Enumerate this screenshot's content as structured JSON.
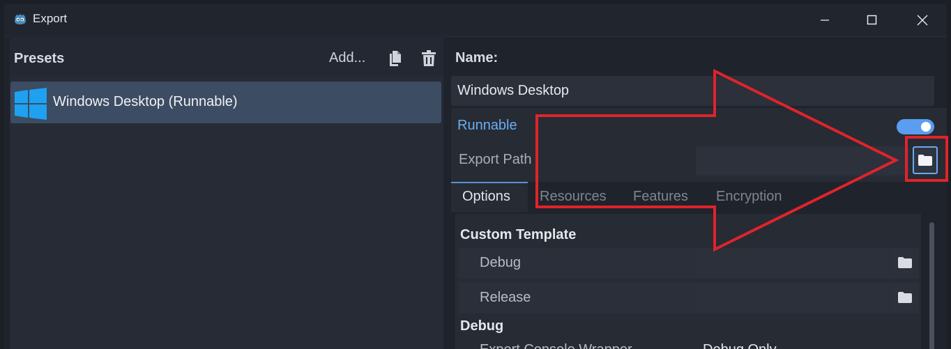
{
  "window": {
    "title": "Export",
    "controls": [
      "minimize",
      "maximize",
      "close"
    ]
  },
  "presets": {
    "title": "Presets",
    "add_label": "Add...",
    "duplicate_icon": "duplicate-icon",
    "delete_icon": "trash-icon",
    "items": [
      {
        "label": "Windows Desktop (Runnable)",
        "icon": "windows-logo-icon",
        "selected": true
      }
    ]
  },
  "details": {
    "name_label": "Name:",
    "name_value": "Windows Desktop",
    "runnable_label": "Runnable",
    "runnable_on": true,
    "export_path_label": "Export Path",
    "export_path_value": ""
  },
  "tabs": [
    {
      "label": "Options",
      "active": true
    },
    {
      "label": "Resources",
      "active": false
    },
    {
      "label": "Features",
      "active": false
    },
    {
      "label": "Encryption",
      "active": false
    }
  ],
  "options": {
    "custom_template_head": "Custom Template",
    "debug_label": "Debug",
    "release_label": "Release",
    "debug_head": "Debug",
    "export_console_label": "Export Console Wrapper",
    "export_console_value": "Debug Only"
  },
  "colors": {
    "accent": "#6aaef2",
    "annotation": "#e0232b",
    "selected_item": "#3c4c62"
  }
}
